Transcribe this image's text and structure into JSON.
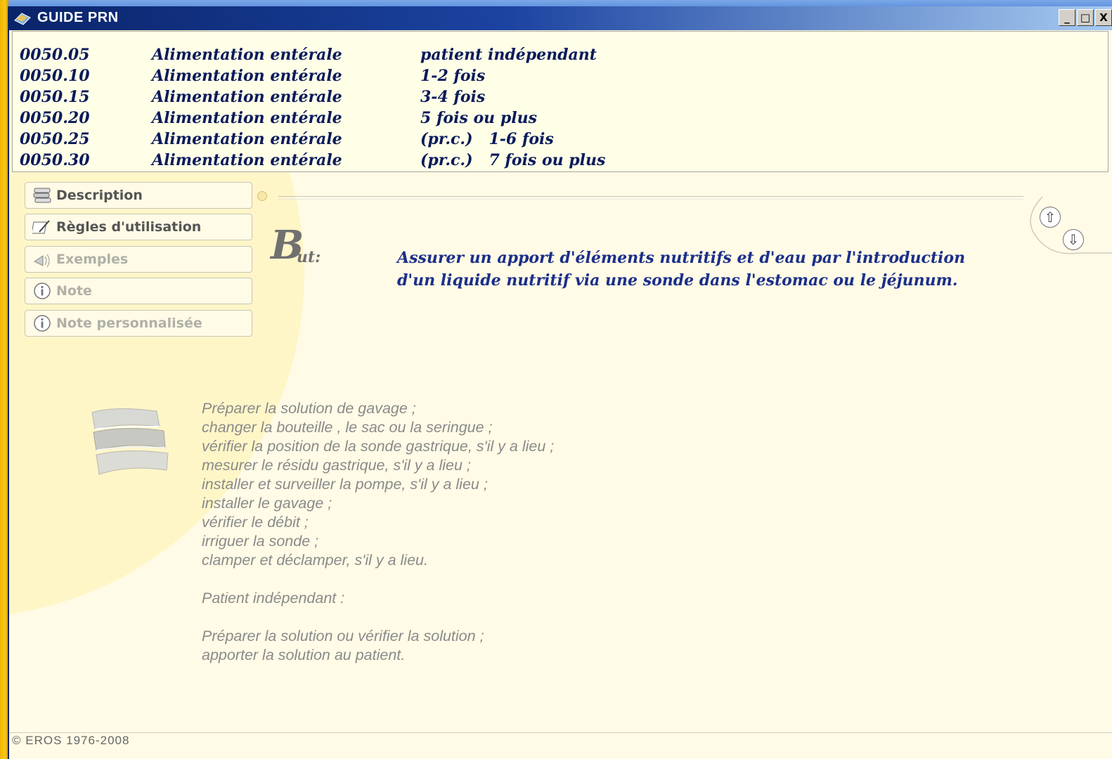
{
  "window": {
    "title": "GUIDE PRN",
    "buttons": {
      "minimize": "_",
      "maximize": "□",
      "close": "X"
    }
  },
  "codes": [
    {
      "code": "0050.05",
      "name": "Alimentation entérale",
      "detail": "patient indépendant"
    },
    {
      "code": "0050.10",
      "name": "Alimentation entérale",
      "detail": "1-2 fois"
    },
    {
      "code": "0050.15",
      "name": "Alimentation entérale",
      "detail": "3-4 fois"
    },
    {
      "code": "0050.20",
      "name": "Alimentation entérale",
      "detail": "5 fois ou plus"
    },
    {
      "code": "0050.25",
      "name": "Alimentation entérale",
      "detail": "(pr.c.)   1-6 fois"
    },
    {
      "code": "0050.30",
      "name": "Alimentation entérale",
      "detail": "(pr.c.)   7 fois ou plus"
    }
  ],
  "nav": [
    {
      "label": "Description",
      "icon": "books-icon",
      "enabled": true
    },
    {
      "label": "Règles d'utilisation",
      "icon": "pencil-note-icon",
      "enabled": true
    },
    {
      "label": "Exemples",
      "icon": "megaphone-icon",
      "enabled": false
    },
    {
      "label": "Note",
      "icon": "info-icon",
      "enabled": false
    },
    {
      "label": "Note personnalisée",
      "icon": "info-icon",
      "enabled": false
    }
  ],
  "section": {
    "heading_initial": "B",
    "heading_rest": "ut:",
    "purpose_lines": [
      "Assurer un apport d'éléments nutritifs et d'eau par l'introduction",
      "d'un liquide nutritif via une sonde dans l'estomac ou le jéjunum."
    ]
  },
  "steps": [
    "Préparer la solution de gavage ;",
    "changer la bouteille , le sac ou la seringue ;",
    "vérifier la position de la sonde gastrique, s'il y a lieu ;",
    "mesurer le résidu gastrique, s'il y a lieu ;",
    "installer et surveiller la pompe, s'il y a lieu ;",
    "installer le gavage ;",
    "vérifier le débit ;",
    "irriguer la sonde ;",
    "clamper et déclamper, s'il y a lieu.",
    "",
    "Patient indépendant :",
    "",
    "Préparer la solution ou vérifier la solution ;",
    "apporter la solution au patient."
  ],
  "scroll": {
    "up": "⇧",
    "down": "⇩"
  },
  "footer": "© EROS 1976-2008"
}
